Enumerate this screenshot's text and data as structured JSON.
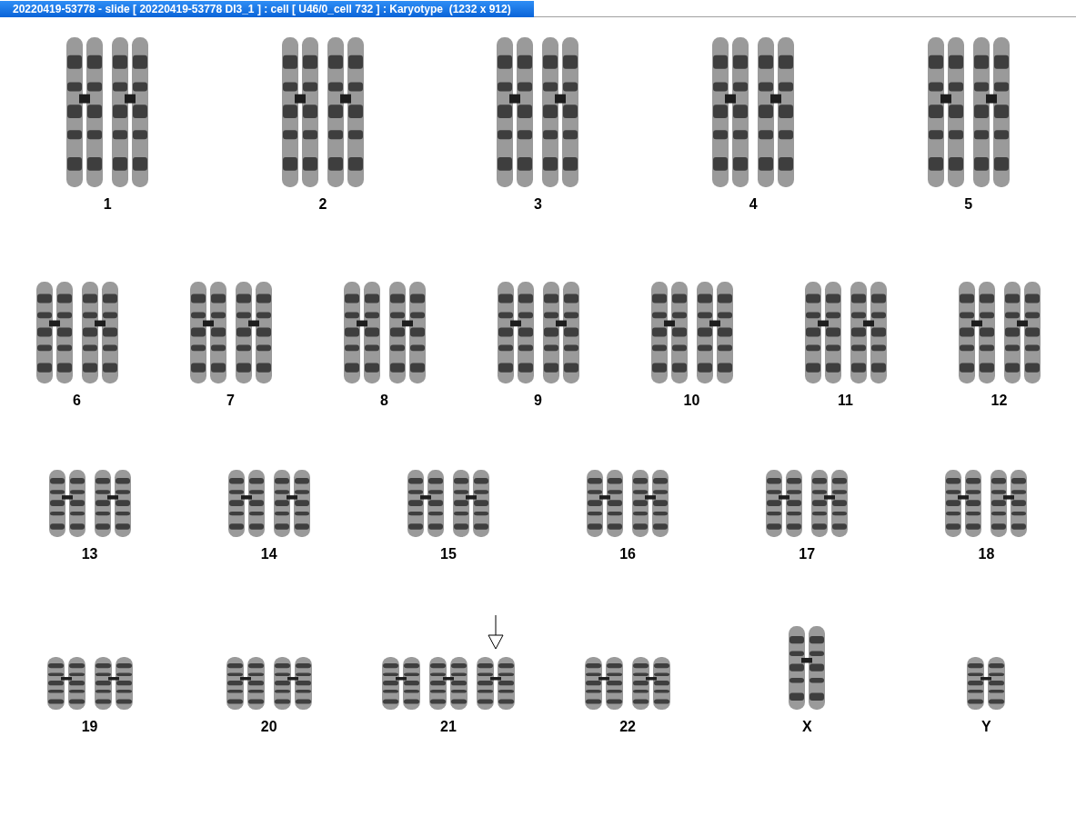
{
  "window": {
    "title": "20220419-53778 - slide [ 20220419-53778 DI3_1 ] : cell [ U46/0_cell 732 ] : Karyotype  (1232 x 912)"
  },
  "rows": [
    {
      "groups": [
        {
          "label": "1",
          "chromosomes": [
            {
              "kind": "long",
              "marked": false
            },
            {
              "kind": "long",
              "marked": false
            }
          ]
        },
        {
          "label": "2",
          "chromosomes": [
            {
              "kind": "long",
              "marked": false
            },
            {
              "kind": "long",
              "marked": false
            }
          ]
        },
        {
          "label": "3",
          "chromosomes": [
            {
              "kind": "long",
              "marked": false
            },
            {
              "kind": "long",
              "marked": false
            }
          ]
        },
        {
          "label": "4",
          "chromosomes": [
            {
              "kind": "long",
              "marked": false
            },
            {
              "kind": "long",
              "marked": false
            }
          ]
        },
        {
          "label": "5",
          "chromosomes": [
            {
              "kind": "long",
              "marked": false
            },
            {
              "kind": "long",
              "marked": false
            }
          ]
        }
      ]
    },
    {
      "groups": [
        {
          "label": "6",
          "chromosomes": [
            {
              "kind": "medium",
              "marked": false
            },
            {
              "kind": "medium",
              "marked": false
            }
          ]
        },
        {
          "label": "7",
          "chromosomes": [
            {
              "kind": "medium",
              "marked": false
            },
            {
              "kind": "medium",
              "marked": false
            }
          ]
        },
        {
          "label": "8",
          "chromosomes": [
            {
              "kind": "medium",
              "marked": false
            },
            {
              "kind": "medium",
              "marked": false
            }
          ]
        },
        {
          "label": "9",
          "chromosomes": [
            {
              "kind": "medium",
              "marked": false
            },
            {
              "kind": "medium",
              "marked": false
            }
          ]
        },
        {
          "label": "10",
          "chromosomes": [
            {
              "kind": "medium",
              "marked": false
            },
            {
              "kind": "medium",
              "marked": false
            }
          ]
        },
        {
          "label": "11",
          "chromosomes": [
            {
              "kind": "medium",
              "marked": false
            },
            {
              "kind": "medium",
              "marked": false
            }
          ]
        },
        {
          "label": "12",
          "chromosomes": [
            {
              "kind": "medium",
              "marked": false
            },
            {
              "kind": "medium",
              "marked": false
            }
          ]
        }
      ]
    },
    {
      "groups": [
        {
          "label": "13",
          "chromosomes": [
            {
              "kind": "short",
              "marked": false
            },
            {
              "kind": "short",
              "marked": false
            }
          ]
        },
        {
          "label": "14",
          "chromosomes": [
            {
              "kind": "short",
              "marked": false
            },
            {
              "kind": "short",
              "marked": false
            }
          ]
        },
        {
          "label": "15",
          "chromosomes": [
            {
              "kind": "short",
              "marked": false
            },
            {
              "kind": "short",
              "marked": false
            }
          ]
        },
        {
          "label": "16",
          "chromosomes": [
            {
              "kind": "short",
              "marked": false
            },
            {
              "kind": "short",
              "marked": false
            }
          ]
        },
        {
          "label": "17",
          "chromosomes": [
            {
              "kind": "short",
              "marked": false
            },
            {
              "kind": "short",
              "marked": false
            }
          ]
        },
        {
          "label": "18",
          "chromosomes": [
            {
              "kind": "short",
              "marked": false
            },
            {
              "kind": "short",
              "marked": false
            }
          ]
        }
      ]
    },
    {
      "groups": [
        {
          "label": "19",
          "chromosomes": [
            {
              "kind": "small",
              "marked": false
            },
            {
              "kind": "small",
              "marked": false
            }
          ]
        },
        {
          "label": "20",
          "chromosomes": [
            {
              "kind": "small",
              "marked": false
            },
            {
              "kind": "small",
              "marked": false
            }
          ]
        },
        {
          "label": "21",
          "chromosomes": [
            {
              "kind": "small",
              "marked": false
            },
            {
              "kind": "small",
              "marked": false
            },
            {
              "kind": "small",
              "marked": true
            }
          ]
        },
        {
          "label": "22",
          "chromosomes": [
            {
              "kind": "small",
              "marked": false
            },
            {
              "kind": "small",
              "marked": false
            }
          ]
        },
        {
          "label": "X",
          "chromosomes": [
            {
              "kind": "mid",
              "marked": false
            }
          ]
        },
        {
          "label": "Y",
          "chromosomes": [
            {
              "kind": "small",
              "marked": false
            }
          ]
        }
      ]
    }
  ]
}
